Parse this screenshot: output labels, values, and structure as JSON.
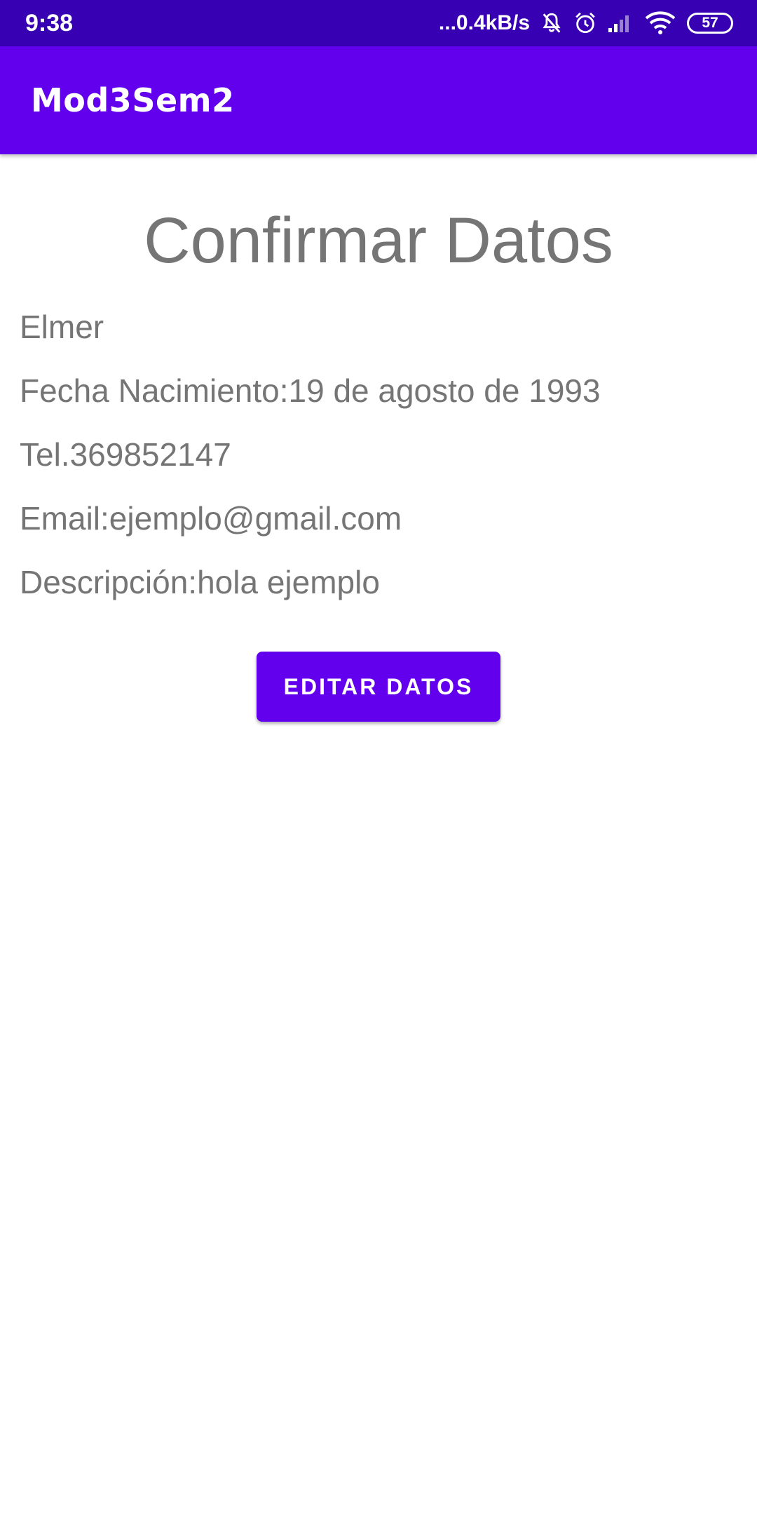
{
  "status_bar": {
    "time": "9:38",
    "net_speed": "...0.4kB/s",
    "battery_level": "57",
    "icons": [
      "mute-icon",
      "alarm-icon",
      "signal-icon",
      "wifi-icon",
      "battery-icon"
    ],
    "background_color": "#3700B3"
  },
  "app_bar": {
    "title": "Mod3Sem2",
    "background_color": "#6200EE"
  },
  "main": {
    "heading": "Confirmar Datos",
    "name": "Elmer",
    "birth_date": "Fecha Nacimiento:19 de agosto de 1993",
    "phone": "Tel.369852147",
    "email": "Email:ejemplo@gmail.com",
    "description": "Descripción:hola ejemplo",
    "edit_button_label": "EDITAR DATOS",
    "text_color": "#757575",
    "button_color": "#6200EE"
  }
}
